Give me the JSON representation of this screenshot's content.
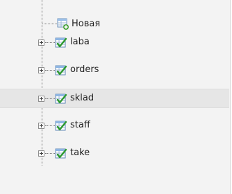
{
  "tree": {
    "new_item": {
      "label": "Новая",
      "icon": "new-table-icon"
    },
    "tables": [
      {
        "label": "laba",
        "icon": "table-icon",
        "selected": false
      },
      {
        "label": "orders",
        "icon": "table-icon",
        "selected": false
      },
      {
        "label": "sklad",
        "icon": "table-icon",
        "selected": true
      },
      {
        "label": "staff",
        "icon": "table-icon",
        "selected": false
      },
      {
        "label": "take",
        "icon": "table-icon",
        "selected": false
      }
    ],
    "expander_icon": "plus-box-icon"
  }
}
